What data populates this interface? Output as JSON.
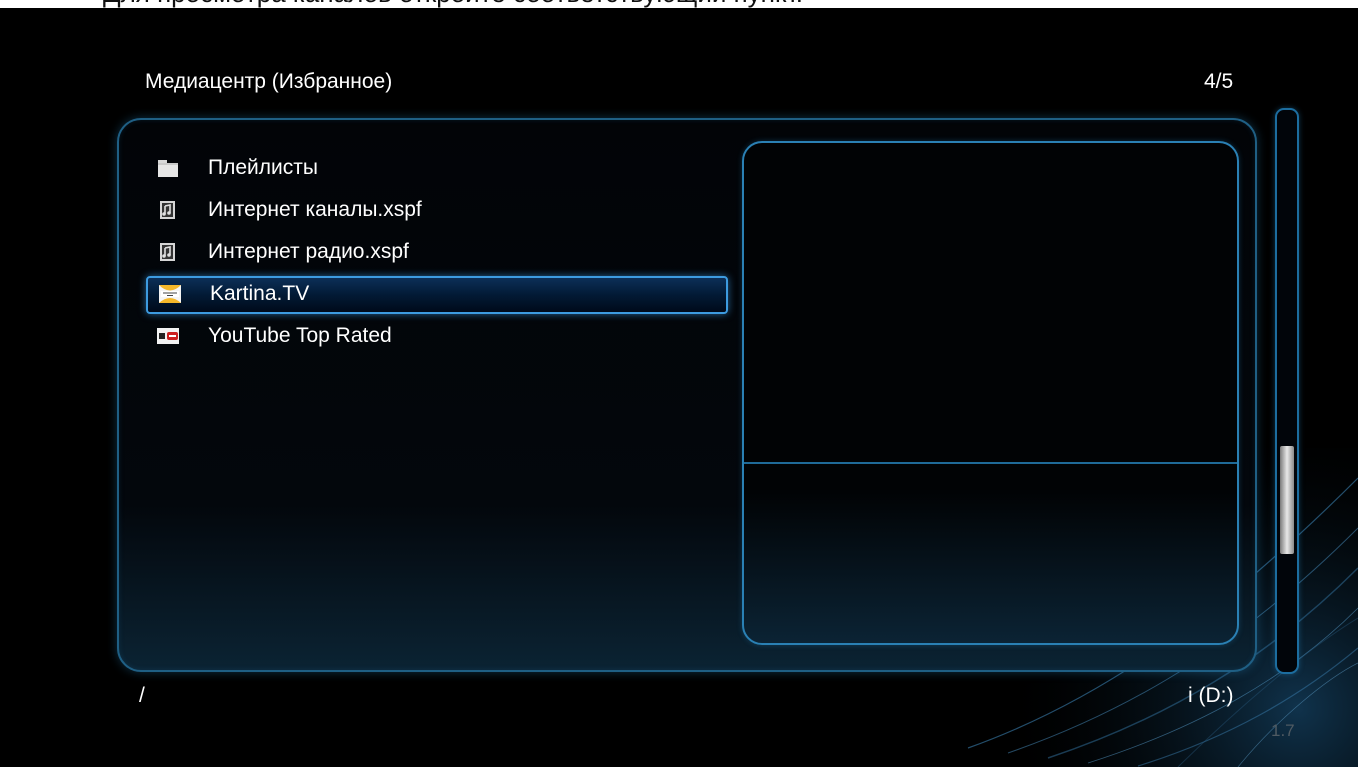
{
  "top_caption": "Для просмотра каналов откройте соответствующий пункт.",
  "header": {
    "title": "Медиацентр (Избранное)",
    "page_counter": "4/5"
  },
  "file_list": [
    {
      "label": "Плейлисты",
      "icon": "folder-icon",
      "selected": false
    },
    {
      "label": "Интернет каналы.xspf",
      "icon": "playlist-icon",
      "selected": false
    },
    {
      "label": "Интернет радио.xspf",
      "icon": "playlist-icon",
      "selected": false
    },
    {
      "label": "Kartina.TV",
      "icon": "kartina-tv-logo-icon",
      "selected": true
    },
    {
      "label": "YouTube Top Rated",
      "icon": "youtube-logo-icon",
      "selected": false
    }
  ],
  "footer": {
    "path": "/",
    "drive": "i (D:)",
    "version": "1.7"
  },
  "scrollbar": {
    "position_fraction": 0.72
  },
  "colors": {
    "accent": "#3d9be0",
    "panel_border": "#1f5f84",
    "background": "#000000"
  }
}
